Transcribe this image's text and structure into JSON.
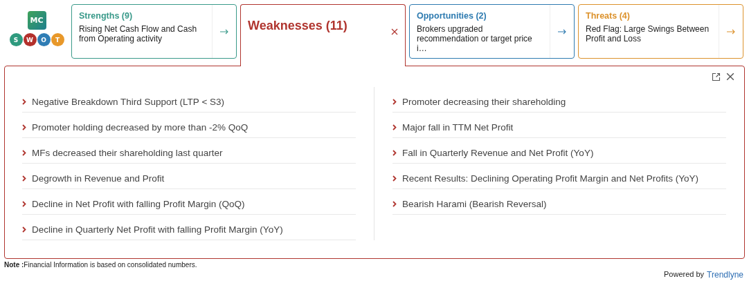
{
  "logo": {
    "badge": "MC",
    "letters": [
      {
        "letter": "S",
        "color": "#2e9a7e"
      },
      {
        "letter": "W",
        "color": "#b3302c"
      },
      {
        "letter": "O",
        "color": "#2f7db5"
      },
      {
        "letter": "T",
        "color": "#e8982a"
      }
    ]
  },
  "tabs": [
    {
      "title": "Strengths (9)",
      "description": "Rising Net Cash Flow and Cash from Operating activity",
      "color": "#3a9a8a",
      "selected": false
    },
    {
      "title": "Weaknesses (11)",
      "color": "#b0352f",
      "selected": true
    },
    {
      "title": "Opportunities (2)",
      "description": "Brokers upgraded recommendation or target price i…",
      "color": "#2e7bb0",
      "selected": false
    },
    {
      "title": "Threats (4)",
      "description": "Red Flag: Large Swings Between Profit and Loss",
      "color": "#dc922c",
      "selected": false
    }
  ],
  "panel": {
    "columns": [
      [
        "Negative Breakdown Third Support (LTP < S3)",
        "Promoter holding decreased by more than -2% QoQ",
        "MFs decreased their shareholding last quarter",
        "Degrowth in Revenue and Profit",
        "Decline in Net Profit with falling Profit Margin (QoQ)",
        "Decline in Quarterly Net Profit with falling Profit Margin (YoY)"
      ],
      [
        "Promoter decreasing their shareholding",
        "Major fall in TTM Net Profit",
        "Fall in Quarterly Revenue and Net Profit (YoY)",
        "Recent Results: Declining Operating Profit Margin and Net Profits (YoY)",
        "Bearish Harami (Bearish Reversal)"
      ]
    ]
  },
  "footer": {
    "note": "**Note :**Financial Information is based on consolidated numbers.",
    "powered_by": "Powered by",
    "brand": "Trendlyne"
  }
}
